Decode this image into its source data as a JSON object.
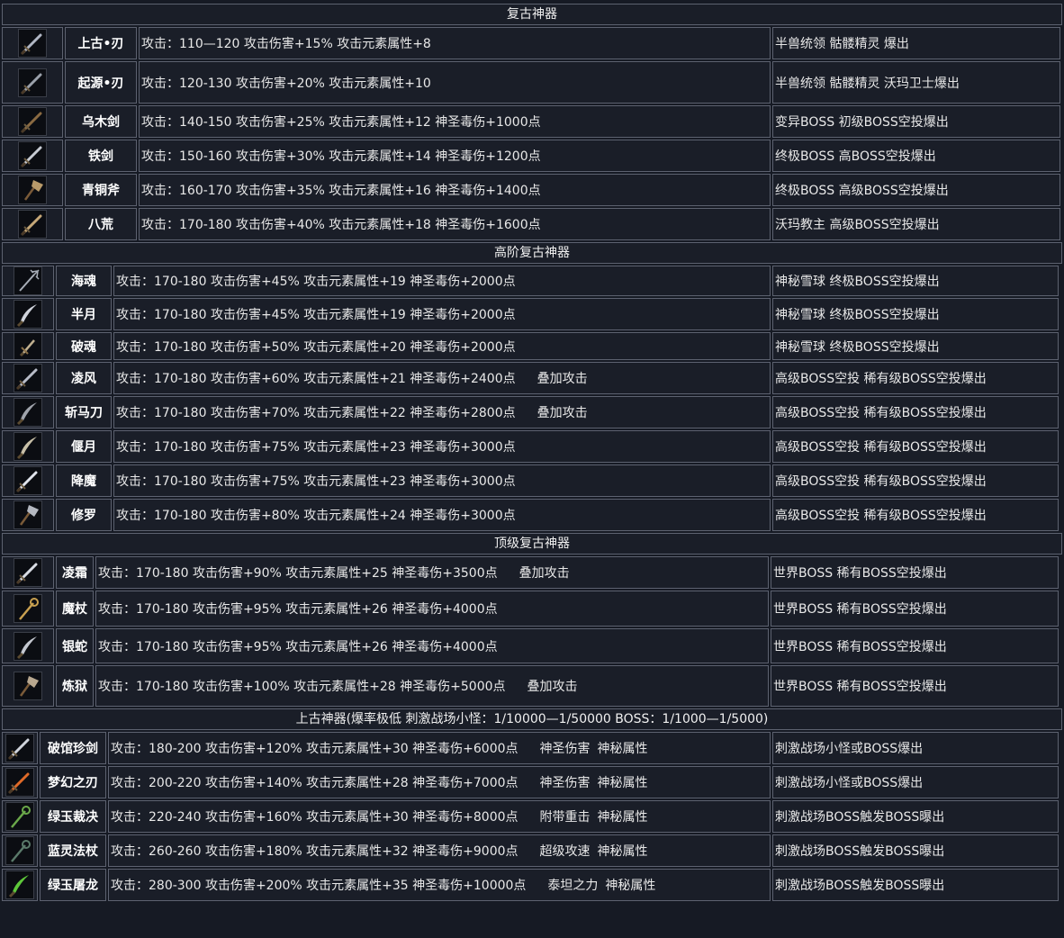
{
  "sections": [
    {
      "title": "复古神器",
      "items": [
        {
          "icon": "sword-icon",
          "name": "上古•刃",
          "attr": "攻击：110—120 攻击伤害+15% 攻击元素属性+8",
          "extra": [],
          "drop": "半兽统领 骷髅精灵 爆出",
          "tint": "#b0b6c4"
        },
        {
          "icon": "sword-icon",
          "name": "起源•刃",
          "attr": "攻击：120-130 攻击伤害+20% 攻击元素属性+10",
          "extra": [],
          "drop": "半兽统领 骷髅精灵 沃玛卫士爆出",
          "tint": "#9aa0aa"
        },
        {
          "icon": "sword-icon",
          "name": "乌木剑",
          "attr": "攻击：140-150 攻击伤害+25% 攻击元素属性+12 神圣毒伤+1000点",
          "extra": [],
          "drop": "变异BOSS 初级BOSS空投爆出",
          "tint": "#8a6a42"
        },
        {
          "icon": "sword-icon",
          "name": "铁剑",
          "attr": "攻击：150-160 攻击伤害+30% 攻击元素属性+14 神圣毒伤+1200点",
          "extra": [],
          "drop": "终极BOSS 高BOSS空投爆出",
          "tint": "#c8ccd4"
        },
        {
          "icon": "axe-icon",
          "name": "青铜斧",
          "attr": "攻击：160-170 攻击伤害+35% 攻击元素属性+16 神圣毒伤+1400点",
          "extra": [],
          "drop": "终极BOSS 高级BOSS空投爆出",
          "tint": "#b89a6a"
        },
        {
          "icon": "sword-icon",
          "name": "八荒",
          "attr": "攻击：170-180 攻击伤害+40% 攻击元素属性+18 神圣毒伤+1600点",
          "extra": [],
          "drop": "沃玛教主 高级BOSS空投爆出",
          "tint": "#c6a878"
        }
      ]
    },
    {
      "title": "高阶复古神器",
      "items": [
        {
          "icon": "trident-icon",
          "name": "海魂",
          "attr": "攻击：170-180 攻击伤害+45% 攻击元素属性+19 神圣毒伤+2000点",
          "extra": [],
          "drop": "神秘雪球 终极BOSS空投爆出",
          "tint": "#a8aeb8"
        },
        {
          "icon": "blade-icon",
          "name": "半月",
          "attr": "攻击：170-180 攻击伤害+45% 攻击元素属性+19 神圣毒伤+2000点",
          "extra": [],
          "drop": "神秘雪球 终极BOSS空投爆出",
          "tint": "#d0d4dc"
        },
        {
          "icon": "dagger-icon",
          "name": "破魂",
          "attr": "攻击：170-180 攻击伤害+50% 攻击元素属性+20 神圣毒伤+2000点",
          "extra": [],
          "drop": "神秘雪球 终极BOSS空投爆出",
          "tint": "#c0b090"
        },
        {
          "icon": "sword-icon",
          "name": "凌风",
          "attr": "攻击：170-180 攻击伤害+60% 攻击元素属性+21 神圣毒伤+2400点",
          "extra": [
            "叠加攻击"
          ],
          "drop": "高级BOSS空投 稀有级BOSS空投爆出",
          "tint": "#b8bcc8"
        },
        {
          "icon": "blade-icon",
          "name": "斩马刀",
          "attr": "攻击：170-180 攻击伤害+70% 攻击元素属性+22 神圣毒伤+2800点",
          "extra": [
            "叠加攻击"
          ],
          "drop": "高级BOSS空投 稀有级BOSS空投爆出",
          "tint": "#a0a4ac"
        },
        {
          "icon": "blade-icon",
          "name": "偃月",
          "attr": "攻击：170-180 攻击伤害+75% 攻击元素属性+23 神圣毒伤+3000点",
          "extra": [],
          "drop": "高级BOSS空投 稀有级BOSS空投爆出",
          "tint": "#c8c0a8"
        },
        {
          "icon": "sword-icon",
          "name": "降魔",
          "attr": "攻击：170-180 攻击伤害+75% 攻击元素属性+23 神圣毒伤+3000点",
          "extra": [],
          "drop": "高级BOSS空投 稀有级BOSS空投爆出",
          "tint": "#e0e4ec"
        },
        {
          "icon": "axe-icon",
          "name": "修罗",
          "attr": "攻击：170-180 攻击伤害+80% 攻击元素属性+24 神圣毒伤+3000点",
          "extra": [],
          "drop": "高级BOSS空投 稀有级BOSS空投爆出",
          "tint": "#b4b8c0"
        }
      ]
    },
    {
      "title": "顶级复古神器",
      "items": [
        {
          "icon": "sword-icon",
          "name": "凌霜",
          "attr": "攻击：170-180 攻击伤害+90% 攻击元素属性+25 神圣毒伤+3500点",
          "extra": [
            "叠加攻击"
          ],
          "drop": "世界BOSS 稀有BOSS空投爆出",
          "tint": "#d8dce4"
        },
        {
          "icon": "staff-icon",
          "name": "魔杖",
          "attr": "攻击：170-180 攻击伤害+95% 攻击元素属性+26 神圣毒伤+4000点",
          "extra": [],
          "drop": "世界BOSS 稀有BOSS空投爆出",
          "tint": "#c8a050"
        },
        {
          "icon": "blade-icon",
          "name": "银蛇",
          "attr": "攻击：170-180 攻击伤害+95% 攻击元素属性+26 神圣毒伤+4000点",
          "extra": [],
          "drop": "世界BOSS 稀有BOSS空投爆出",
          "tint": "#c4c8d0"
        },
        {
          "icon": "axe-icon",
          "name": "炼狱",
          "attr": "攻击：170-180 攻击伤害+100% 攻击元素属性+28 神圣毒伤+5000点",
          "extra": [
            "叠加攻击"
          ],
          "drop": "世界BOSS 稀有BOSS空投爆出",
          "tint": "#b8a890"
        }
      ]
    },
    {
      "title": "上古神器(爆率极低 刺激战场小怪：1/10000—1/50000 BOSS：1/1000—1/5000)",
      "items": [
        {
          "icon": "sword-icon",
          "name": "破馆珍剑",
          "attr": "攻击：180-200 攻击伤害+120% 攻击元素属性+30 神圣毒伤+6000点",
          "extra": [
            "神圣伤害",
            "神秘属性"
          ],
          "drop": "刺激战场小怪或BOSS爆出",
          "tint": "#d0d4dc"
        },
        {
          "icon": "sword-icon",
          "name": "梦幻之刃",
          "attr": "攻击：200-220 攻击伤害+140% 攻击元素属性+28 神圣毒伤+7000点",
          "extra": [
            "神圣伤害",
            "神秘属性"
          ],
          "drop": "刺激战场小怪或BOSS爆出",
          "tint": "#e06a28"
        },
        {
          "icon": "staff-icon",
          "name": "绿玉裁决",
          "attr": "攻击：220-240 攻击伤害+160% 攻击元素属性+30 神圣毒伤+8000点",
          "extra": [
            "附带重击",
            "神秘属性"
          ],
          "drop": "刺激战场BOSS触发BOSS曝出",
          "tint": "#6aa84a"
        },
        {
          "icon": "staff-icon",
          "name": "蓝灵法杖",
          "attr": "攻击：260-260 攻击伤害+180% 攻击元素属性+32 神圣毒伤+9000点",
          "extra": [
            "超级攻速",
            "神秘属性"
          ],
          "drop": "刺激战场BOSS触发BOSS曝出",
          "tint": "#5a7a6a"
        },
        {
          "icon": "blade-icon",
          "name": "绿玉屠龙",
          "attr": "攻击：280-300 攻击伤害+200% 攻击元素属性+35 神圣毒伤+10000点",
          "extra": [
            "泰坦之力",
            "神秘属性"
          ],
          "drop": "刺激战场BOSS触发BOSS曝出",
          "tint": "#5ec83a"
        }
      ]
    }
  ]
}
